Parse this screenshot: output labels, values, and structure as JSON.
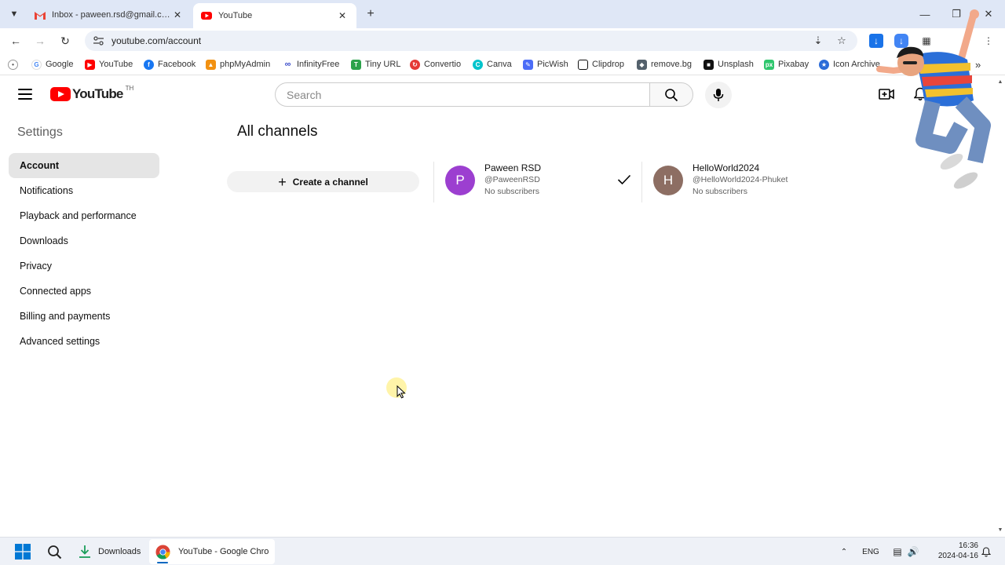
{
  "browser": {
    "tabs": [
      {
        "title": "Inbox - paween.rsd@gmail.com",
        "favicon": "gmail-icon",
        "active": false
      },
      {
        "title": "YouTube",
        "favicon": "youtube-icon",
        "active": true
      }
    ],
    "url": "youtube.com/account",
    "bookmarks": [
      {
        "label": "Google",
        "icon": "google-icon",
        "color": "#4285f4"
      },
      {
        "label": "YouTube",
        "icon": "youtube-icon",
        "color": "#ff0000"
      },
      {
        "label": "Facebook",
        "icon": "facebook-icon",
        "color": "#1877f2"
      },
      {
        "label": "phpMyAdmin",
        "icon": "phpmyadmin-icon",
        "color": "#f29111"
      },
      {
        "label": "InfinityFree",
        "icon": "infinity-icon",
        "color": "#3b4cca"
      },
      {
        "label": "Tiny URL",
        "icon": "tinyurl-icon",
        "color": "#2ca24b"
      },
      {
        "label": "Convertio",
        "icon": "convertio-icon",
        "color": "#e53935"
      },
      {
        "label": "Canva",
        "icon": "canva-icon",
        "color": "#00c4cc"
      },
      {
        "label": "PicWish",
        "icon": "picwish-icon",
        "color": "#4b6cf7"
      },
      {
        "label": "Clipdrop",
        "icon": "clipdrop-icon",
        "color": "#111111"
      },
      {
        "label": "remove.bg",
        "icon": "removebg-icon",
        "color": "#54616c"
      },
      {
        "label": "Unsplash",
        "icon": "unsplash-icon",
        "color": "#111111"
      },
      {
        "label": "Pixabay",
        "icon": "pixabay-icon",
        "color": "#2ec66d"
      },
      {
        "label": "Icon Archive",
        "icon": "iconarchive-icon",
        "color": "#2b6cd8"
      }
    ]
  },
  "masthead": {
    "logo_text": "YouTube",
    "country_code": "TH",
    "search_placeholder": "Search"
  },
  "settings": {
    "title": "Settings",
    "items": [
      {
        "label": "Account",
        "active": true
      },
      {
        "label": "Notifications",
        "active": false
      },
      {
        "label": "Playback and performance",
        "active": false
      },
      {
        "label": "Downloads",
        "active": false
      },
      {
        "label": "Privacy",
        "active": false
      },
      {
        "label": "Connected apps",
        "active": false
      },
      {
        "label": "Billing and payments",
        "active": false
      },
      {
        "label": "Advanced settings",
        "active": false
      }
    ]
  },
  "main": {
    "title": "All channels",
    "create_label": "Create a channel",
    "channels": [
      {
        "initial": "P",
        "name": "Paween RSD",
        "handle": "@PaweenRSD",
        "subscribers": "No subscribers",
        "color": "#9c3fd0",
        "selected": true
      },
      {
        "initial": "H",
        "name": "HelloWorld2024",
        "handle": "@HelloWorld2024-Phuket",
        "subscribers": "No subscribers",
        "color": "#8d6e63",
        "selected": false
      }
    ]
  },
  "taskbar": {
    "apps": [
      {
        "label": "Downloads",
        "icon": "download-folder-icon"
      },
      {
        "label": "YouTube - Google Chro",
        "icon": "chrome-icon"
      }
    ],
    "language": "ENG",
    "time": "16:36",
    "date": "2024-04-16"
  },
  "colors": {
    "accent": "#065fd4",
    "youtube_red": "#ff0000",
    "active_nav_bg": "#e5e5e5"
  }
}
